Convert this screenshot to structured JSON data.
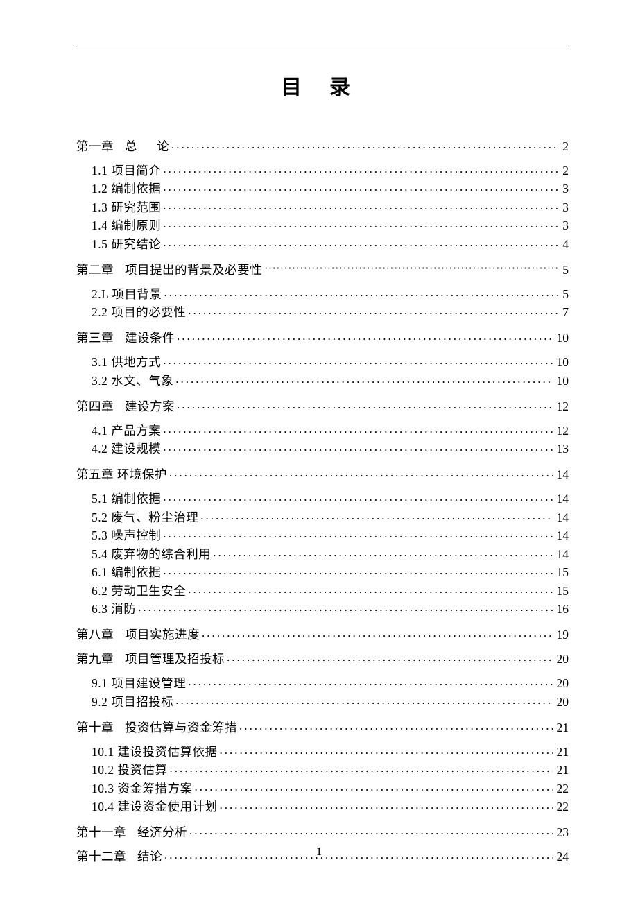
{
  "title": "目录",
  "page_number": "1",
  "toc": [
    {
      "type": "chapter",
      "label_parts": [
        "第一章",
        "总",
        "论"
      ],
      "spacing": "wide",
      "page": "2",
      "leader": "dots",
      "first": true
    },
    {
      "type": "sub",
      "label": "1.1 项目简介",
      "page": "2",
      "leader": "dots"
    },
    {
      "type": "sub",
      "label": "1.2 编制依据",
      "page": "3",
      "leader": "dots"
    },
    {
      "type": "sub",
      "label": "1.3 研究范围",
      "page": "3",
      "leader": "dots"
    },
    {
      "type": "sub",
      "label": "1.4 编制原则",
      "page": "3",
      "leader": "dots"
    },
    {
      "type": "sub",
      "label": "1.5 研究结论",
      "page": "4",
      "leader": "dots"
    },
    {
      "type": "chapter",
      "label_parts": [
        "第二章",
        "项目提出的背景及必要性"
      ],
      "spacing": "normal",
      "page": "5",
      "leader": "dense"
    },
    {
      "type": "sub",
      "label": "2.L 项目背景",
      "page": "5",
      "leader": "dots"
    },
    {
      "type": "sub",
      "label": "2.2 项目的必要性",
      "page": "7",
      "leader": "dots"
    },
    {
      "type": "chapter",
      "label_parts": [
        "第三章",
        "建设条件"
      ],
      "spacing": "normal",
      "page": "10",
      "leader": "dots"
    },
    {
      "type": "sub",
      "label": "3.1 供地方式",
      "page": "10",
      "leader": "dots"
    },
    {
      "type": "sub",
      "label": "3.2 水文、气象",
      "page": "10",
      "leader": "dots"
    },
    {
      "type": "chapter",
      "label_parts": [
        "第四章",
        "建设方案"
      ],
      "spacing": "normal",
      "page": "12",
      "leader": "dots"
    },
    {
      "type": "sub",
      "label": "4.1 产品方案",
      "page": "12",
      "leader": "dots"
    },
    {
      "type": "sub",
      "label": "4.2 建设规模",
      "page": "13",
      "leader": "dots"
    },
    {
      "type": "chapter",
      "label_parts": [
        "第五章",
        "环境保护"
      ],
      "spacing": "tight",
      "page": "14",
      "leader": "dots"
    },
    {
      "type": "sub",
      "label": "5.1 编制依据",
      "page": "14",
      "leader": "dots"
    },
    {
      "type": "sub",
      "label": "5.2 废气、粉尘治理",
      "page": "14",
      "leader": "dots"
    },
    {
      "type": "sub",
      "label": "5.3 噪声控制",
      "page": "14",
      "leader": "dots"
    },
    {
      "type": "sub",
      "label": "5.4 废弃物的综合利用",
      "page": "14",
      "leader": "dots"
    },
    {
      "type": "sub",
      "label": "6.1 编制依据",
      "page": "15",
      "leader": "dots"
    },
    {
      "type": "sub",
      "label": "6.2 劳动卫生安全",
      "page": "15",
      "leader": "dots"
    },
    {
      "type": "sub",
      "label": "6.3 消防",
      "page": "16",
      "leader": "dots"
    },
    {
      "type": "chapter",
      "label_parts": [
        "第八章",
        "项目实施进度"
      ],
      "spacing": "normal",
      "page": "19",
      "leader": "dots"
    },
    {
      "type": "chapter",
      "label_parts": [
        "第九章",
        "项目管理及招投标"
      ],
      "spacing": "normal",
      "page": "20",
      "leader": "dots",
      "tight_top": true
    },
    {
      "type": "sub",
      "label": "9.1 项目建设管理",
      "page": "20",
      "leader": "dots"
    },
    {
      "type": "sub",
      "label": "9.2 项目招投标",
      "page": "20",
      "leader": "dots"
    },
    {
      "type": "chapter",
      "label_parts": [
        "第十章",
        "投资估算与资金筹措"
      ],
      "spacing": "normal",
      "page": "21",
      "leader": "dots"
    },
    {
      "type": "sub",
      "label": "10.1 建设投资估算依据",
      "page": "21",
      "leader": "dots"
    },
    {
      "type": "sub",
      "label": "10.2 投资估算",
      "page": "21",
      "leader": "dots"
    },
    {
      "type": "sub",
      "label": "10.3 资金筹措方案",
      "page": "22",
      "leader": "dots"
    },
    {
      "type": "sub",
      "label": "10.4 建设资金使用计划",
      "page": "22",
      "leader": "dots"
    },
    {
      "type": "chapter",
      "label_parts": [
        "第十一章",
        "经济分析"
      ],
      "spacing": "normal",
      "page": "23",
      "leader": "dots"
    },
    {
      "type": "chapter",
      "label_parts": [
        "第十二章",
        "结论"
      ],
      "spacing": "normal",
      "page": "24",
      "leader": "dots",
      "tight_top": true
    }
  ]
}
